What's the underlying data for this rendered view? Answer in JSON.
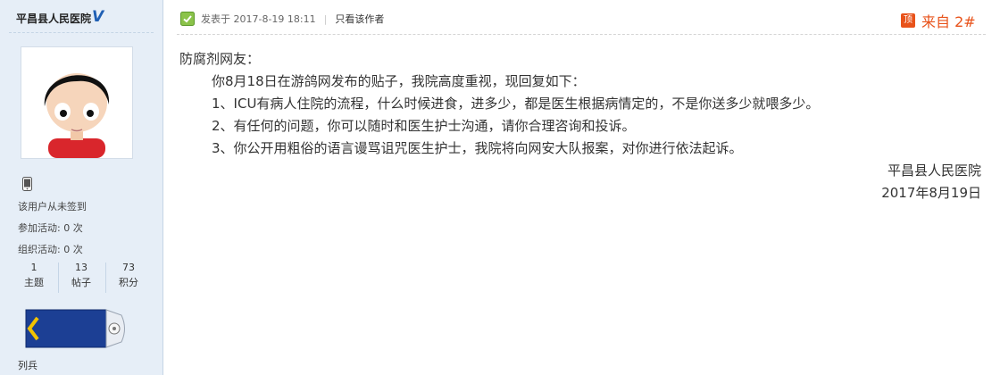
{
  "sidebar": {
    "author_name": "平昌县人民医院",
    "checkin_text": "该用户从未签到",
    "activities_joined_label": "参加活动:",
    "activities_joined_value": "0 次",
    "activities_organized_label": "组织活动:",
    "activities_organized_value": "0 次",
    "stats": [
      {
        "value": "1",
        "label": "主题"
      },
      {
        "value": "13",
        "label": "帖子"
      },
      {
        "value": "73",
        "label": "积分"
      }
    ],
    "rank": "列兵"
  },
  "post": {
    "posted_at": "发表于 2017-8-19 18:11",
    "author_only_link": "只看该作者",
    "top_badge": "顶",
    "floor": "来自 2#",
    "lines": {
      "greeting": "防腐剂网友：",
      "intro": "你8月18日在游鸽网发布的贴子，我院高度重视，现回复如下：",
      "point1": "1、ICU有病人住院的流程，什么时候进食，进多少，都是医生根据病情定的，不是你送多少就喂多少。",
      "point2": "2、有任何的问题，你可以随时和医生护士沟通，请你合理咨询和投诉。",
      "point3": "3、你公开用粗俗的语言谩骂诅咒医生护士，我院将向网安大队报案，对你进行依法起诉。",
      "signature": "平昌县人民医院",
      "date": "2017年8月19日"
    }
  },
  "colors": {
    "sidebar_bg": "#e6eef7",
    "accent": "#e8521a",
    "verify_blue": "#1f5fb4"
  }
}
